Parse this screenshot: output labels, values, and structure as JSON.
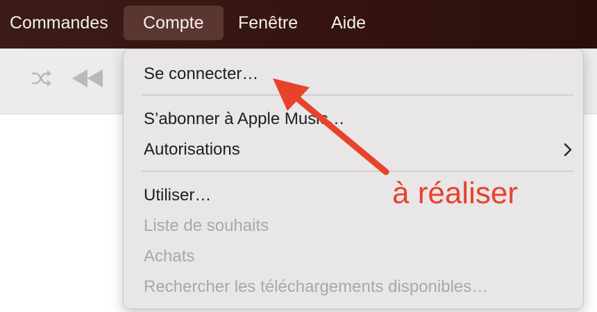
{
  "menubar": {
    "items": [
      {
        "label": "Commandes"
      },
      {
        "label": "Compte"
      },
      {
        "label": "Fenêtre"
      },
      {
        "label": "Aide"
      }
    ],
    "active_index": 1
  },
  "toolbar": {
    "icons": [
      "shuffle-icon",
      "rewind-icon"
    ]
  },
  "menu": {
    "items": [
      {
        "label": "Se connecter…",
        "enabled": true
      },
      {
        "label": "S’abonner à Apple Music…",
        "enabled": true
      },
      {
        "label": "Autorisations",
        "enabled": true,
        "submenu": true
      },
      {
        "label": "Utiliser…",
        "enabled": true
      },
      {
        "label": "Liste de souhaits",
        "enabled": false
      },
      {
        "label": "Achats",
        "enabled": false
      },
      {
        "label": "Rechercher les téléchargements disponibles…",
        "enabled": false
      }
    ]
  },
  "annotation": {
    "text": "à réaliser",
    "color": "#e8422b"
  },
  "colors": {
    "menubar_bg": "#3a1a14",
    "menu_bg": "#e8e6e7",
    "disabled_text": "#a9a7a8"
  }
}
